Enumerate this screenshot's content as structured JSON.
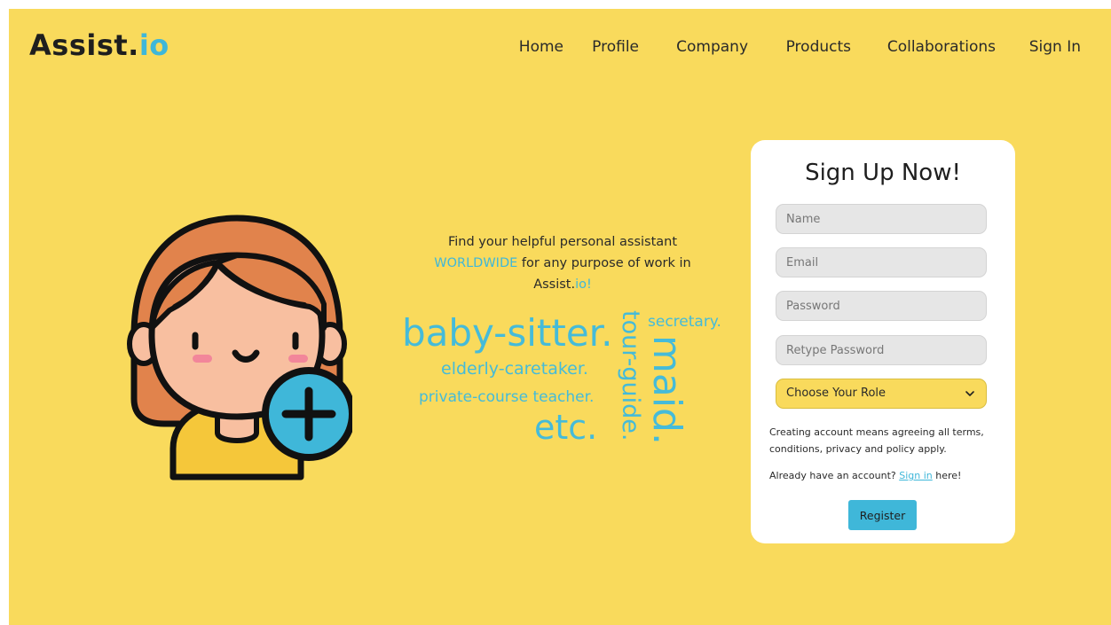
{
  "header": {
    "logo_main": "Assist.",
    "logo_accent": "io",
    "nav": [
      "Home",
      "Profile",
      "Company",
      "Products",
      "Collaborations",
      "Sign In"
    ]
  },
  "hero": {
    "tagline_line1": "Find your helpful personal assistant",
    "tagline_highlight": "WORLDWIDE",
    "tagline_line2_rest": " for any purpose of work in",
    "tagline_brand_main": "Assist.",
    "tagline_brand_accent": "io!",
    "words": {
      "baby_sitter": "baby-sitter.",
      "elderly": "elderly-caretaker.",
      "private": "private-course teacher.",
      "etc": "etc.",
      "secretary": "secretary.",
      "tour_guide": "tour-guide.",
      "maid": "maid."
    }
  },
  "signup": {
    "title": "Sign Up Now!",
    "name_placeholder": "Name",
    "email_placeholder": "Email",
    "password_placeholder": "Password",
    "retype_placeholder": "Retype Password",
    "role_selected": "Choose Your Role",
    "terms": "Creating account means agreeing all terms, conditions, privacy and policy apply.",
    "already_prefix": "Already have an account? ",
    "signin_link": "Sign in",
    "already_suffix": " here!",
    "register_label": "Register"
  },
  "colors": {
    "background": "#f9da5c",
    "accent": "#3fb7d9",
    "text": "#1e1e1e",
    "card": "#ffffff"
  },
  "icons": {
    "avatar": "girl-avatar-with-plus-icon",
    "role_dropdown": "chevron-down-icon"
  }
}
